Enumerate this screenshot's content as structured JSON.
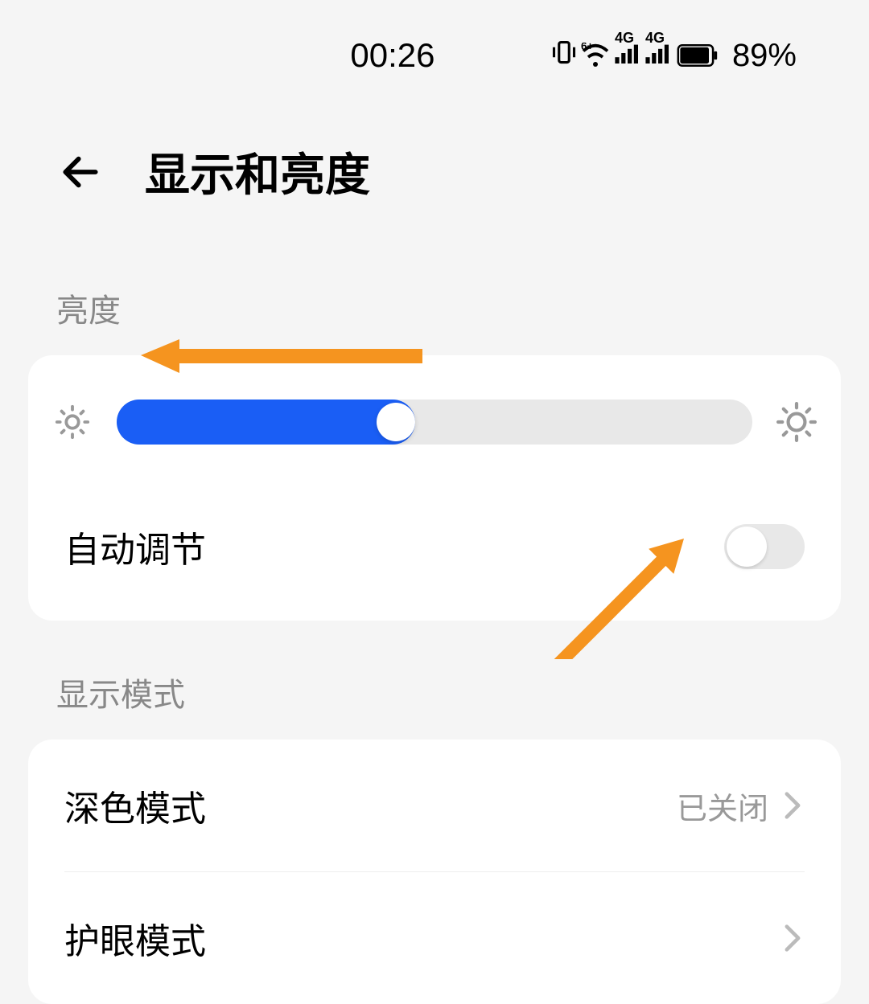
{
  "status_bar": {
    "time": "00:26",
    "battery_percent": "89%"
  },
  "header": {
    "title": "显示和亮度"
  },
  "brightness": {
    "section_label": "亮度",
    "slider_percent": 47,
    "auto_adjust_label": "自动调节",
    "auto_adjust_enabled": false
  },
  "display_mode": {
    "section_label": "显示模式",
    "items": [
      {
        "label": "深色模式",
        "value": "已关闭"
      },
      {
        "label": "护眼模式",
        "value": ""
      }
    ]
  },
  "colors": {
    "accent": "#1a5ef5",
    "annotation": "#f5941f"
  }
}
